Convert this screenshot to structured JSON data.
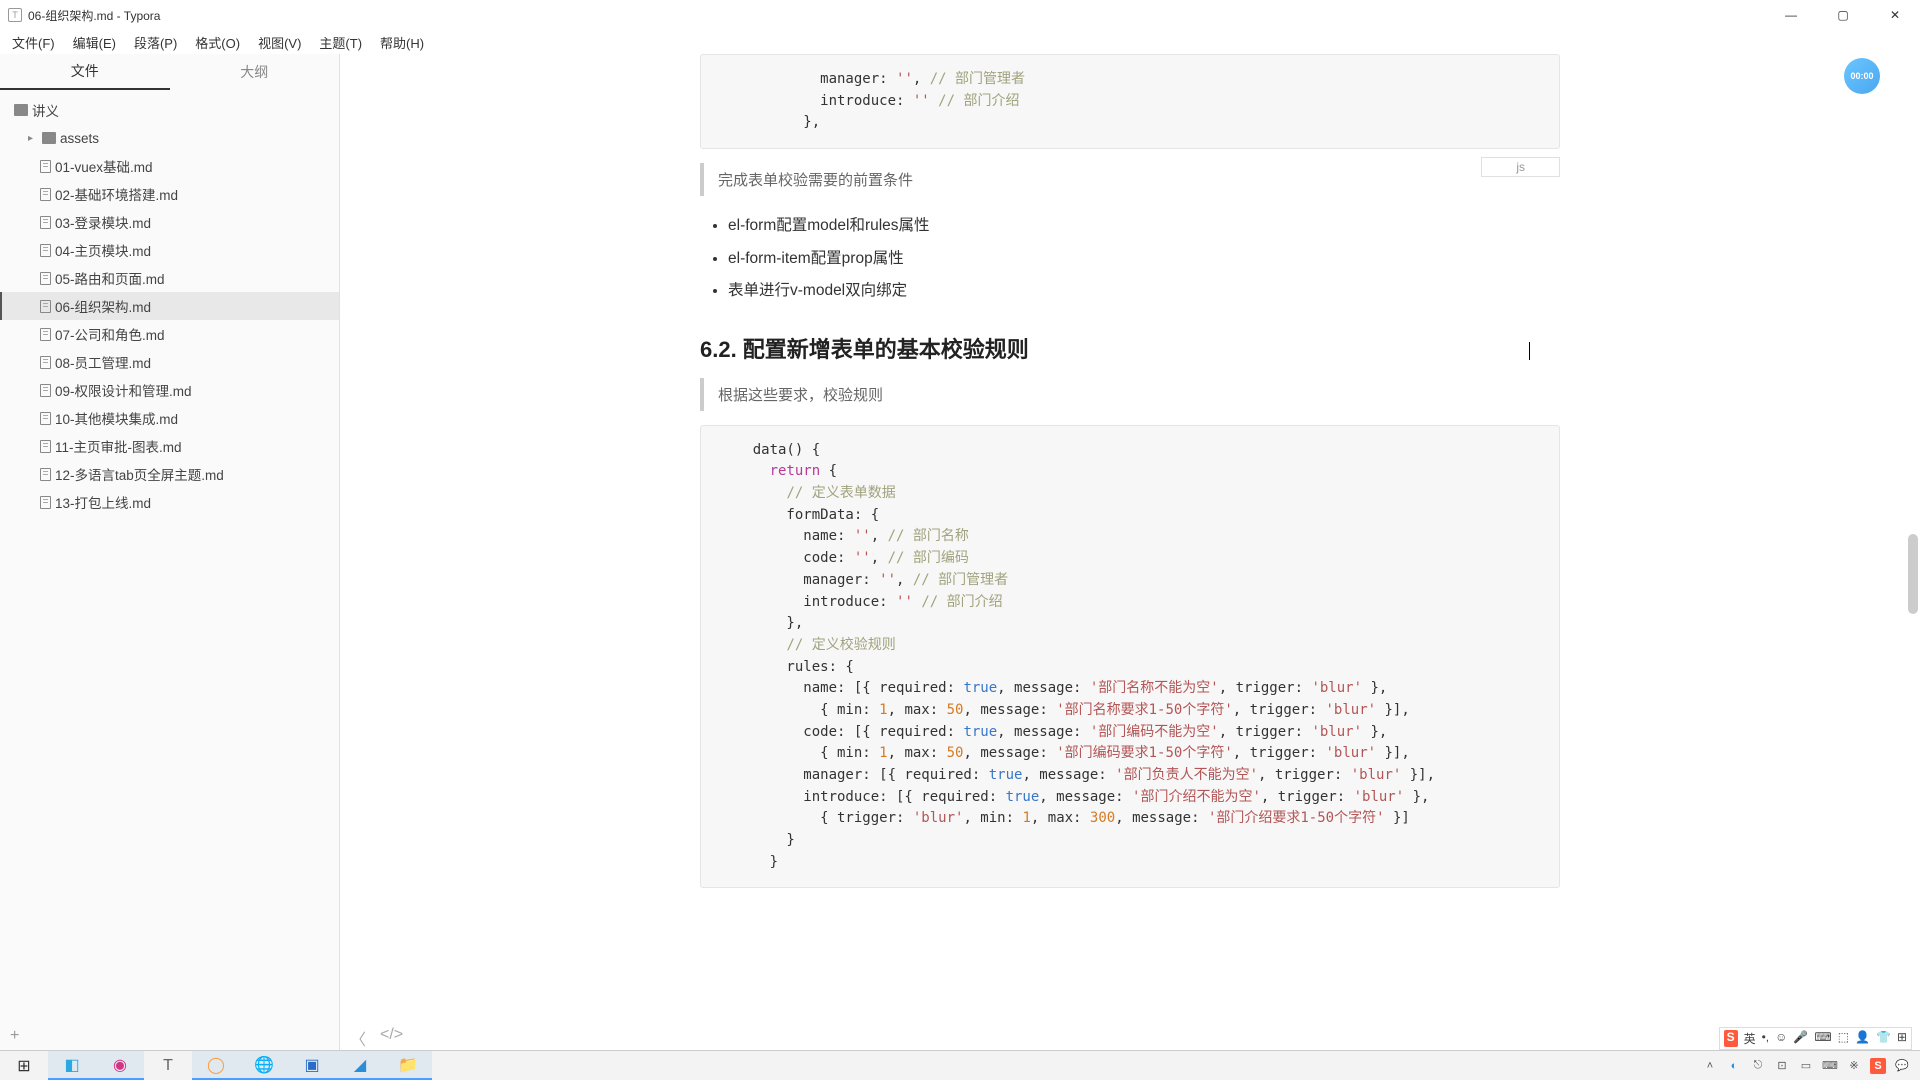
{
  "titlebar": {
    "title": "06-组织架构.md - Typora"
  },
  "menubar": [
    "文件(F)",
    "编辑(E)",
    "段落(P)",
    "格式(O)",
    "视图(V)",
    "主题(T)",
    "帮助(H)"
  ],
  "sidebar": {
    "tabs": [
      "文件",
      "大纲"
    ],
    "root": "讲义",
    "folder": "assets",
    "files": [
      "01-vuex基础.md",
      "02-基础环境搭建.md",
      "03-登录模块.md",
      "04-主页模块.md",
      "05-路由和页面.md",
      "06-组织架构.md",
      "07-公司和角色.md",
      "08-员工管理.md",
      "09-权限设计和管理.md",
      "10-其他模块集成.md",
      "11-主页审批-图表.md",
      "12-多语言tab页全屏主题.md",
      "13-打包上线.md"
    ],
    "selectedIndex": 5
  },
  "content": {
    "codeTop": "            manager: '', // 部门管理者\n            introduce: '' // 部门介绍\n          },",
    "bq1": "完成表单校验需要的前置条件",
    "lang": "js",
    "bullets": [
      "el-form配置model和rules属性",
      "el-form-item配置prop属性",
      "表单进行v-model双向绑定"
    ],
    "heading": "6.2. 配置新增表单的基本校验规则",
    "bq2": "根据这些要求，校验规则"
  },
  "timer": "00:00",
  "code2": {
    "l1": "    data() {",
    "l2_a": "      ",
    "l2_b": "return",
    "l2_c": " {",
    "l3_a": "        ",
    "l3_b": "// 定义表单数据",
    "l4": "        formData: {",
    "l5_a": "          name: ",
    "l5_b": "''",
    "l5_c": ", ",
    "l5_d": "// 部门名称",
    "l6_a": "          code: ",
    "l6_b": "''",
    "l6_c": ", ",
    "l6_d": "// 部门编码",
    "l7_a": "          manager: ",
    "l7_b": "''",
    "l7_c": ", ",
    "l7_d": "// 部门管理者",
    "l8_a": "          introduce: ",
    "l8_b": "''",
    "l8_c": " ",
    "l8_d": "// 部门介绍",
    "l9": "        },",
    "l10_a": "        ",
    "l10_b": "// 定义校验规则",
    "l11": "        rules: {",
    "l12_a": "          name: [{ required: ",
    "l12_b": "true",
    "l12_c": ", message: ",
    "l12_d": "'部门名称不能为空'",
    "l12_e": ", trigger: ",
    "l12_f": "'blur'",
    "l12_g": " },",
    "l13_a": "            { min: ",
    "l13_b": "1",
    "l13_c": ", max: ",
    "l13_d": "50",
    "l13_e": ", message: ",
    "l13_f": "'部门名称要求1-50个字符'",
    "l13_g": ", trigger: ",
    "l13_h": "'blur'",
    "l13_i": " }],",
    "l14_a": "          code: [{ required: ",
    "l14_b": "true",
    "l14_c": ", message: ",
    "l14_d": "'部门编码不能为空'",
    "l14_e": ", trigger: ",
    "l14_f": "'blur'",
    "l14_g": " },",
    "l15_a": "            { min: ",
    "l15_b": "1",
    "l15_c": ", max: ",
    "l15_d": "50",
    "l15_e": ", message: ",
    "l15_f": "'部门编码要求1-50个字符'",
    "l15_g": ", trigger: ",
    "l15_h": "'blur'",
    "l15_i": " }],",
    "l16_a": "          manager: [{ required: ",
    "l16_b": "true",
    "l16_c": ", message: ",
    "l16_d": "'部门负责人不能为空'",
    "l16_e": ", trigger: ",
    "l16_f": "'blur'",
    "l16_g": " }],",
    "l17_a": "          introduce: [{ required: ",
    "l17_b": "true",
    "l17_c": ", message: ",
    "l17_d": "'部门介绍不能为空'",
    "l17_e": ", trigger: ",
    "l17_f": "'blur'",
    "l17_g": " },",
    "l18_a": "            { trigger: ",
    "l18_b": "'blur'",
    "l18_c": ", min: ",
    "l18_d": "1",
    "l18_e": ", max: ",
    "l18_f": "300",
    "l18_g": ", message: ",
    "l18_h": "'部门介绍要求1-50个字符'",
    "l18_i": " }]",
    "l19": "        }",
    "l20": "      }"
  },
  "ime": [
    "S",
    "英",
    "•,",
    "☺",
    "🎤",
    "⌨",
    "⬚",
    "👤",
    "👕",
    "⊞"
  ]
}
